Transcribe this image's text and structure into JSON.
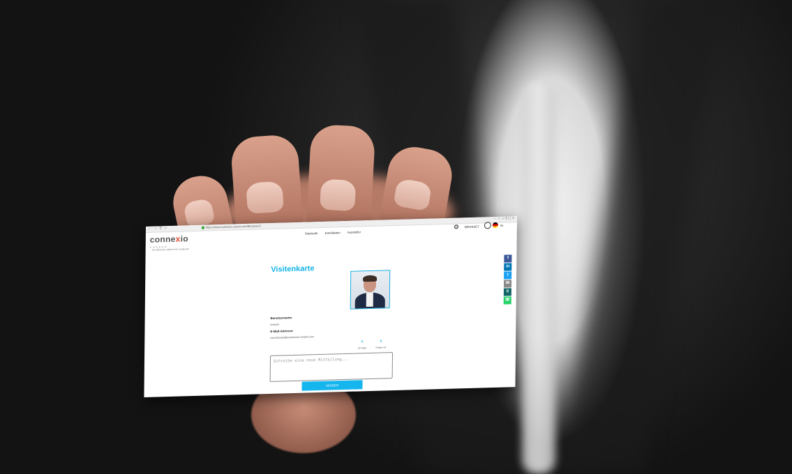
{
  "browser": {
    "nav_icons": "← → C ⌂",
    "url": "https://www.connexio-career.com/Benutzer/1",
    "right_icons": "⋯ ☆ ✩   ⫴ ▢ ≡"
  },
  "site": {
    "logo_prefix": "conne",
    "logo_x": "x",
    "logo_suffix": "io",
    "logo_sub": "CAREER",
    "tagline": "Die führende Jobbörse für Frankreich",
    "nav": [
      "Startseite",
      "Kandidaten",
      "Aussteller"
    ],
    "user_label": "BROSSET",
    "language": "de"
  },
  "card": {
    "title": "Visitenkarte",
    "username_label": "Benutzername:",
    "username_value": "brossel",
    "email_label": "E-Mail-Adresse:",
    "email_value": "marcbrossel@connexion-emploi.com",
    "stats": [
      {
        "value": "0",
        "label": "Ich folge"
      },
      {
        "value": "0",
        "label": "Folgen mir"
      }
    ],
    "message_placeholder": "Schreibe eine neue Mitteilung...",
    "send_label": "SENDEN"
  },
  "social": [
    {
      "icon": "facebook-icon",
      "glyph": "f",
      "color": "#3b5998"
    },
    {
      "icon": "linkedin-icon",
      "glyph": "in",
      "color": "#0077b5"
    },
    {
      "icon": "twitter-icon",
      "glyph": "t",
      "color": "#1da1f2"
    },
    {
      "icon": "email-icon",
      "glyph": "✉",
      "color": "#8a8a8a"
    },
    {
      "icon": "xing-icon",
      "glyph": "X",
      "color": "#126567"
    },
    {
      "icon": "whatsapp-icon",
      "glyph": "☏",
      "color": "#25d366"
    }
  ]
}
